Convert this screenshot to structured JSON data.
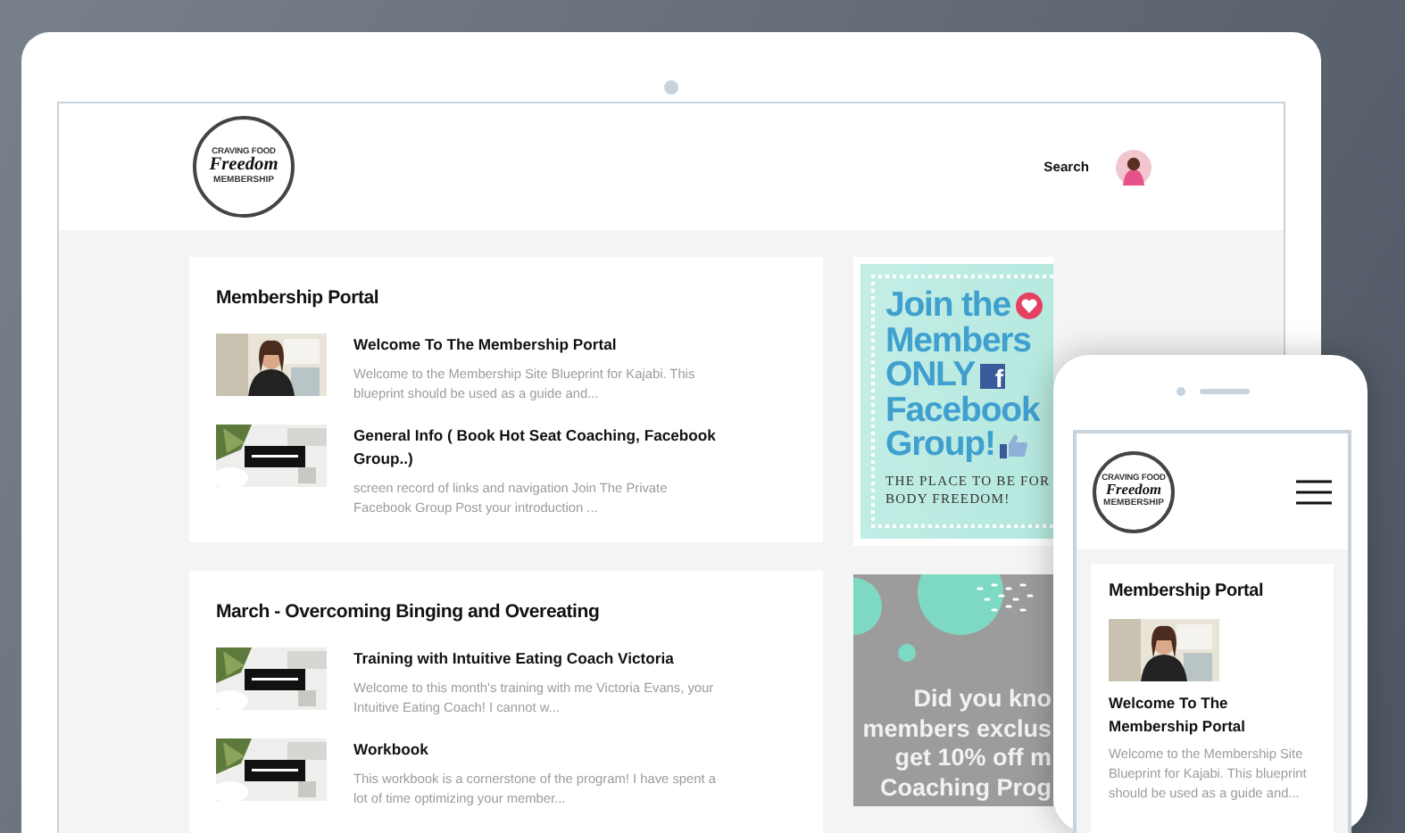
{
  "desktop": {
    "logo": {
      "top": "CRAVING FOOD",
      "script": "Freedom",
      "bottom": "MEMBERSHIP"
    },
    "search": "Search",
    "sections": [
      {
        "title": "Membership Portal",
        "lessons": [
          {
            "title": "Welcome To The Membership Portal",
            "description": "Welcome to the Membership Site Blueprint for Kajabi. This blueprint should be used as a guide and..."
          },
          {
            "title": "General Info ( Book Hot Seat Coaching, Facebook Group..)",
            "description": "screen record of links and navigation Join The Private Facebook Group Post your introduction ..."
          }
        ]
      },
      {
        "title": "March - Overcoming Binging and Overeating",
        "lessons": [
          {
            "title": "Training with Intuitive Eating Coach Victoria",
            "description": "Welcome to this month's training with me Victoria Evans, your Intuitive Eating Coach! I cannot w..."
          },
          {
            "title": "Workbook",
            "description": "This workbook is a cornerstone of the program! I have spent a lot of time optimizing your member..."
          }
        ]
      }
    ],
    "banners": [
      {
        "kind": "teal",
        "headline": [
          "Join the",
          "Members",
          "ONLY",
          "Facebook",
          "Group!"
        ],
        "glyph": "f",
        "tagline": [
          "THE PLACE TO BE FOR",
          "BODY FREEDOM!"
        ]
      },
      {
        "kind": "gray",
        "headline": [
          "Did you kno",
          "members exclus",
          "get 10% off m",
          "Coaching Prog"
        ]
      }
    ]
  },
  "mobile": {
    "logo": {
      "top": "CRAVING FOOD",
      "script": "Freedom",
      "bottom": "MEMBERSHIP"
    },
    "section": {
      "title": "Membership Portal",
      "lesson": {
        "title": "Welcome To The Membership Portal",
        "description": "Welcome to the Membership Site Blueprint for Kajabi. This blueprint should be used as a guide and..."
      }
    }
  }
}
